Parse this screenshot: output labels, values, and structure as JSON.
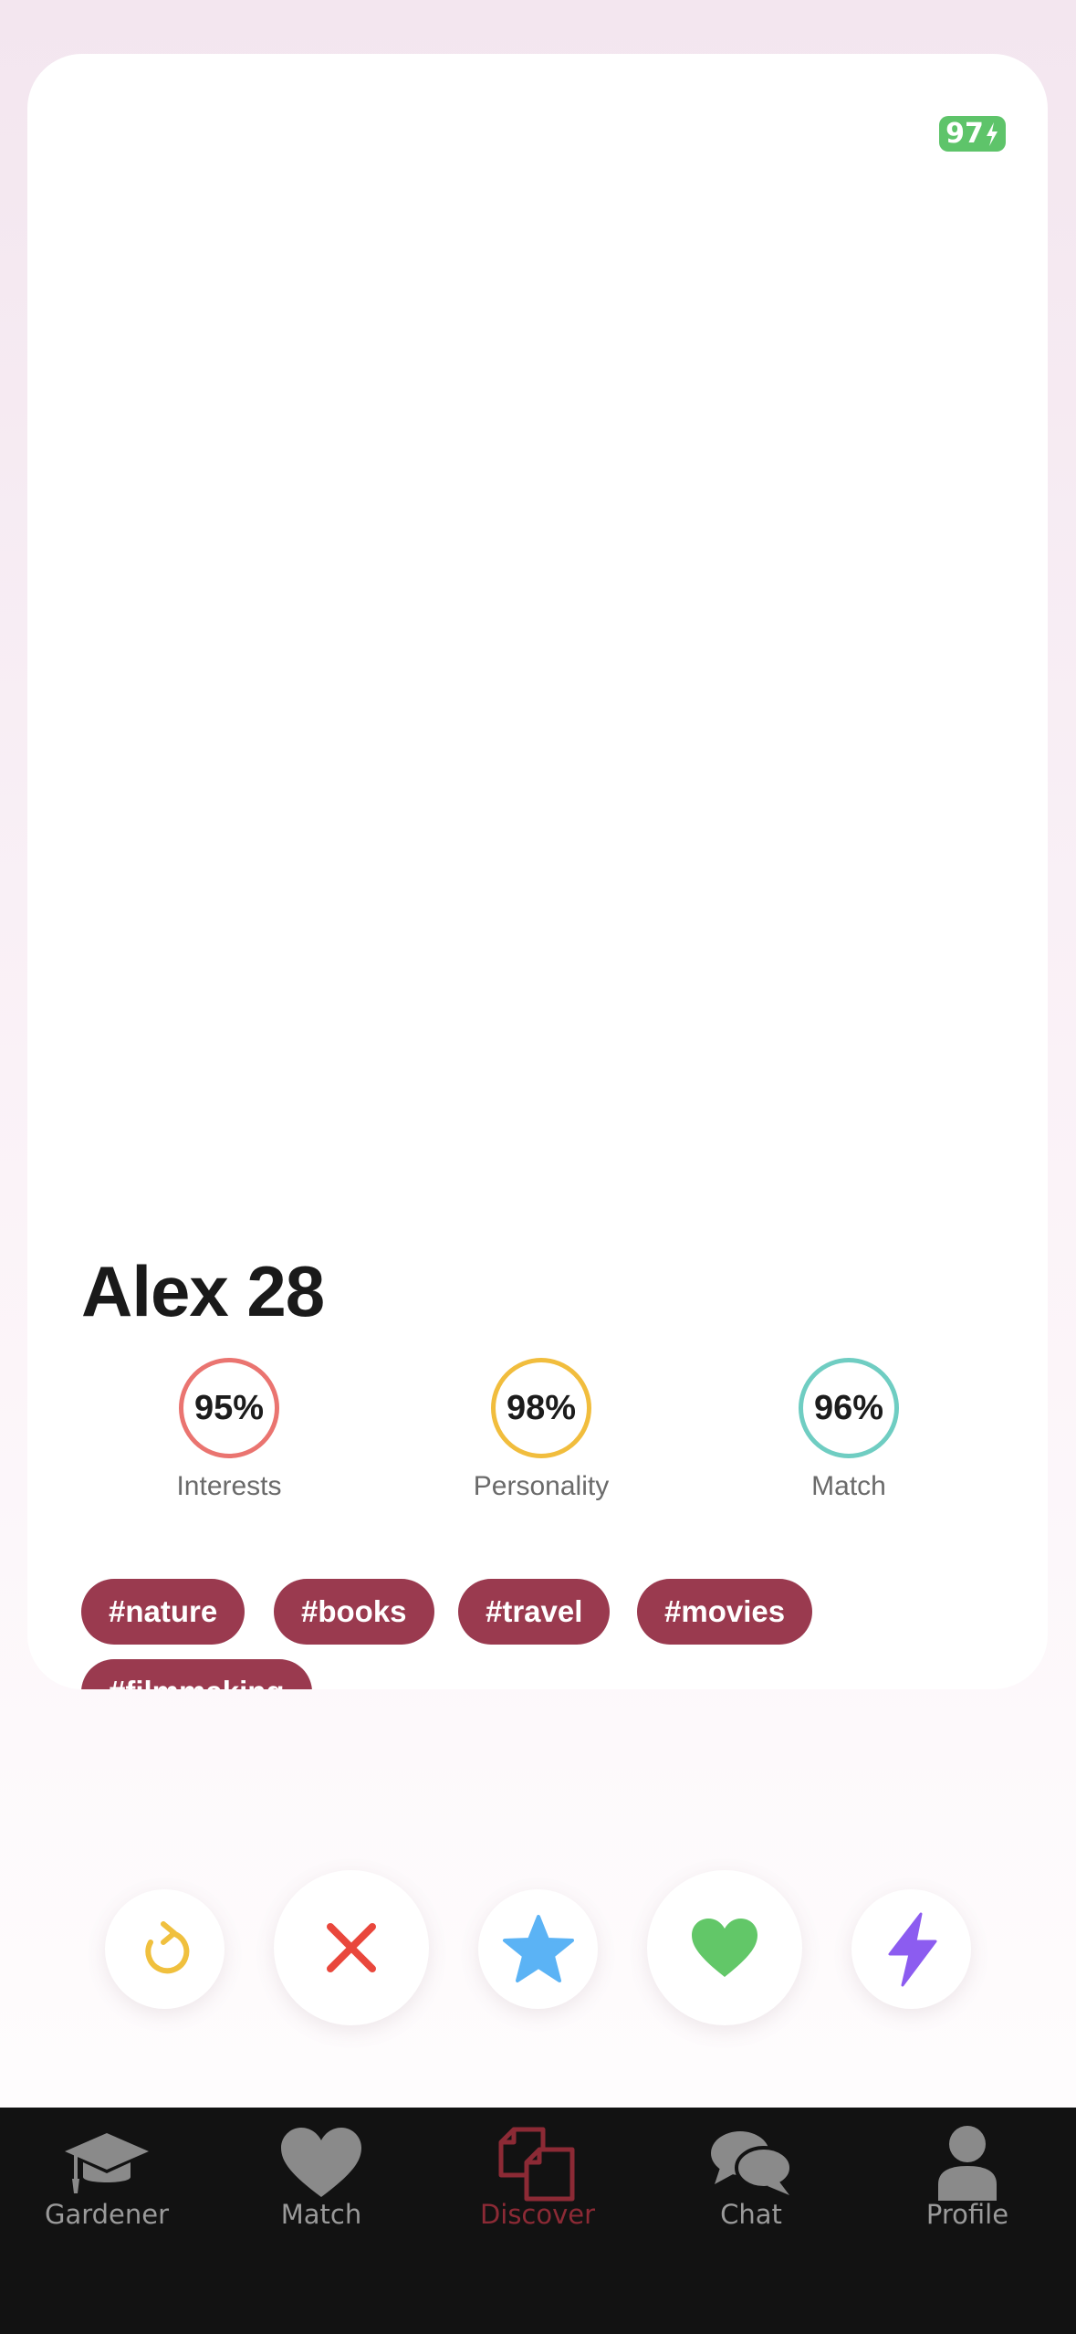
{
  "status": {
    "battery": "97"
  },
  "profile": {
    "name_age": "Alex 28"
  },
  "scores": [
    {
      "value": "95%",
      "label": "Interests",
      "color": "#ea7470"
    },
    {
      "value": "98%",
      "label": "Personality",
      "color": "#f1bd3d"
    },
    {
      "value": "96%",
      "label": "Match",
      "color": "#6fcdc2"
    }
  ],
  "tags": [
    "#nature",
    "#books",
    "#travel",
    "#movies",
    "#filmmaking"
  ],
  "actions": [
    {
      "icon": "undo-icon",
      "color": "#f0c03e"
    },
    {
      "icon": "close-icon",
      "color": "#e9473c"
    },
    {
      "icon": "star-icon",
      "color": "#5bb3f5"
    },
    {
      "icon": "heart-icon",
      "color": "#62c768"
    },
    {
      "icon": "bolt-icon",
      "color": "#8c5cf0"
    }
  ],
  "tabs": [
    {
      "label": "Gardener",
      "icon": "graduation-cap-icon"
    },
    {
      "label": "Match",
      "icon": "heart-icon"
    },
    {
      "label": "Discover",
      "icon": "cards-icon",
      "active": true
    },
    {
      "label": "Chat",
      "icon": "chat-bubbles-icon"
    },
    {
      "label": "Profile",
      "icon": "person-icon"
    }
  ],
  "colors": {
    "tag_bg": "#9a3a4f",
    "active_tab": "#8c2a35",
    "tab_inactive": "#9a9a9a",
    "battery": "#5ec46a"
  }
}
